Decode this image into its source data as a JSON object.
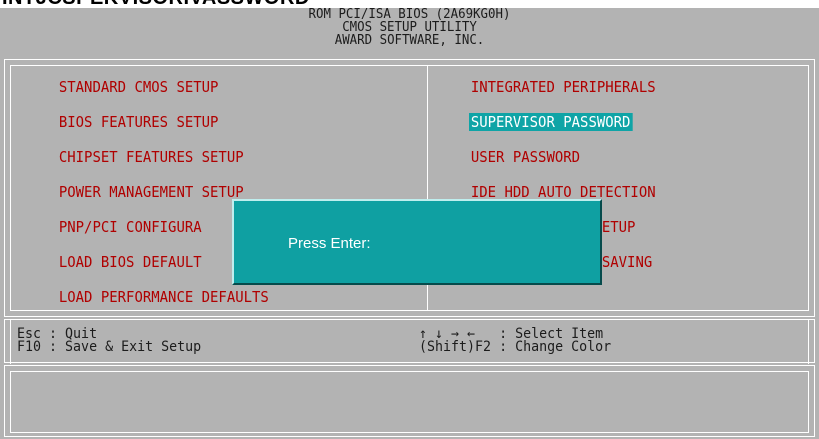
{
  "caption": "INTJCSPEKVISORIVASSWORD",
  "header": {
    "line1": "ROM PCI/ISA BIOS (2A69KG0H)",
    "line2": "CMOS SETUP UTILITY",
    "line3": "AWARD SOFTWARE, INC."
  },
  "menu": {
    "left": [
      "STANDARD CMOS SETUP",
      "BIOS FEATURES SETUP",
      "CHIPSET FEATURES SETUP",
      "POWER MANAGEMENT SETUP",
      "PNP/PCI CONFIGURA",
      "LOAD BIOS DEFAULT",
      "LOAD PERFORMANCE DEFAULTS"
    ],
    "right": [
      "INTEGRATED PERIPHERALS",
      "SUPERVISOR PASSWORD",
      "USER PASSWORD",
      "IDE HDD AUTO DETECTION",
      "ETUP",
      "SAVING"
    ],
    "selected": "SUPERVISOR PASSWORD"
  },
  "help": {
    "esc": "Esc : Quit",
    "f10": "F10 : Save & Exit Setup",
    "arrows": "↑ ↓ → ←   : Select Item",
    "shift_f2": "(Shift)F2 : Change Color"
  },
  "dialog": {
    "label": "Press Enter:"
  },
  "colors": {
    "screen_bg": "#b3b3b3",
    "menu_text": "#b00000",
    "highlight": "#0fa4a6",
    "dialog_bg": "#0fa0a2"
  }
}
